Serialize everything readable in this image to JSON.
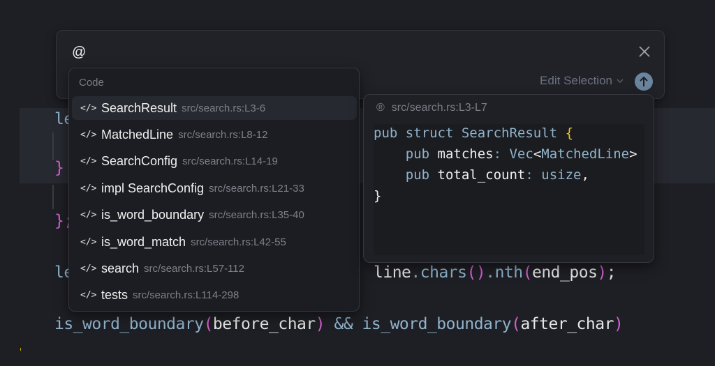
{
  "editor": {
    "line1_start": "le",
    "brace_close": "}",
    "brace_close_semi": "};",
    "line4_start": "le",
    "line4_end": {
      "a": "line",
      "b": ".",
      "c": "chars",
      "d": "(",
      "e": ")",
      "f": ".",
      "g": "nth",
      "h": "(",
      "i": "end_pos",
      "j": ")",
      "k": ";"
    },
    "line5": {
      "fn1": "is_word_boundary",
      "arg1": "before_char",
      "op": "&&",
      "fn2": "is_word_boundary",
      "arg2": "after_char",
      "po": "(",
      "pc": ")"
    }
  },
  "input": {
    "value": "@",
    "close_icon": "close-icon",
    "mode_label": "Edit Selection",
    "send_icon": "arrow-up-icon"
  },
  "dropdown": {
    "header": "Code",
    "items": [
      {
        "name": "SearchResult",
        "path": "src/search.rs:L3-6",
        "selected": true
      },
      {
        "name": "MatchedLine",
        "path": "src/search.rs:L8-12"
      },
      {
        "name": "SearchConfig",
        "path": "src/search.rs:L14-19"
      },
      {
        "name": "impl SearchConfig",
        "path": "src/search.rs:L21-33"
      },
      {
        "name": "is_word_boundary",
        "path": "src/search.rs:L35-40"
      },
      {
        "name": "is_word_match",
        "path": "src/search.rs:L42-55"
      },
      {
        "name": "search",
        "path": "src/search.rs:L57-112"
      },
      {
        "name": "tests",
        "path": "src/search.rs:L114-298"
      }
    ],
    "item_icon": "code-icon"
  },
  "preview": {
    "path": "src/search.rs:L3-L7",
    "code": {
      "l1": {
        "a": "pub struct ",
        "b": "SearchResult",
        "c": " {"
      },
      "l2": {
        "a": "    pub ",
        "b": "matches",
        "c": ": ",
        "d": "Vec",
        "e": "<",
        "f": "MatchedLine",
        "g": ">"
      },
      "l3": {
        "a": "    pub ",
        "b": "total_count",
        "c": ": ",
        "d": "usize",
        "e": ","
      },
      "l4": {
        "a": "}"
      }
    }
  },
  "colors": {
    "background": "#1e1f24",
    "keyword": "#8fb3cc",
    "paren": "#d35fcf",
    "brace": "#f0c419",
    "send_button": "#6b859e"
  }
}
